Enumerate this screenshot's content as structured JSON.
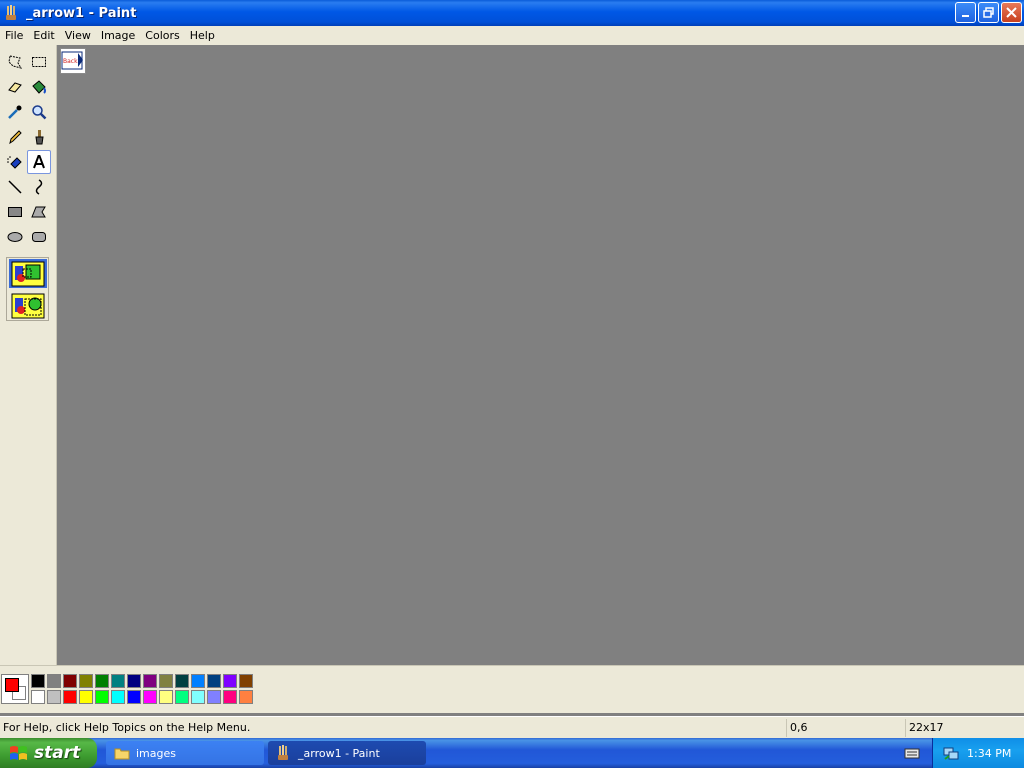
{
  "window": {
    "title": "_arrow1 - Paint"
  },
  "menu": [
    "File",
    "Edit",
    "View",
    "Image",
    "Colors",
    "Help"
  ],
  "tools": [
    {
      "name": "free-form-select",
      "icon": "free-select-icon"
    },
    {
      "name": "select",
      "icon": "rect-select-icon"
    },
    {
      "name": "eraser",
      "icon": "eraser-icon"
    },
    {
      "name": "fill",
      "icon": "fill-bucket-icon"
    },
    {
      "name": "pick-color",
      "icon": "eyedropper-icon"
    },
    {
      "name": "magnifier",
      "icon": "magnifier-icon"
    },
    {
      "name": "pencil",
      "icon": "pencil-icon"
    },
    {
      "name": "brush",
      "icon": "brush-icon"
    },
    {
      "name": "airbrush",
      "icon": "airbrush-icon"
    },
    {
      "name": "text",
      "icon": "text-icon",
      "selected": true
    },
    {
      "name": "line",
      "icon": "line-icon"
    },
    {
      "name": "curve",
      "icon": "curve-icon"
    },
    {
      "name": "rectangle",
      "icon": "rectangle-icon"
    },
    {
      "name": "polygon",
      "icon": "polygon-icon"
    },
    {
      "name": "ellipse",
      "icon": "ellipse-icon"
    },
    {
      "name": "rounded-rectangle",
      "icon": "rounded-rect-icon"
    }
  ],
  "tool_options": [
    "opaque-background-icon",
    "transparent-background-icon"
  ],
  "colors": {
    "foreground": "#ff0000",
    "background": "#ffffff",
    "palette_row1": [
      "#000000",
      "#808080",
      "#800000",
      "#808000",
      "#008000",
      "#008080",
      "#000080",
      "#800080",
      "#808040",
      "#004040",
      "#0080ff",
      "#004080",
      "#8000ff",
      "#804000"
    ],
    "palette_row2": [
      "#ffffff",
      "#c0c0c0",
      "#ff0000",
      "#ffff00",
      "#00ff00",
      "#00ffff",
      "#0000ff",
      "#ff00ff",
      "#ffff80",
      "#00ff80",
      "#80ffff",
      "#8080ff",
      "#ff0080",
      "#ff8040"
    ]
  },
  "status": {
    "help_text": "For Help, click Help Topics on the Help Menu.",
    "coords": "0,6",
    "size": "22x17"
  },
  "taskbar": {
    "start_label": "start",
    "items": [
      {
        "label": "images",
        "icon": "folder-icon",
        "active": false
      },
      {
        "label": "_arrow1 - Paint",
        "icon": "paint-icon",
        "active": true
      }
    ],
    "clock": "1:34 PM"
  }
}
